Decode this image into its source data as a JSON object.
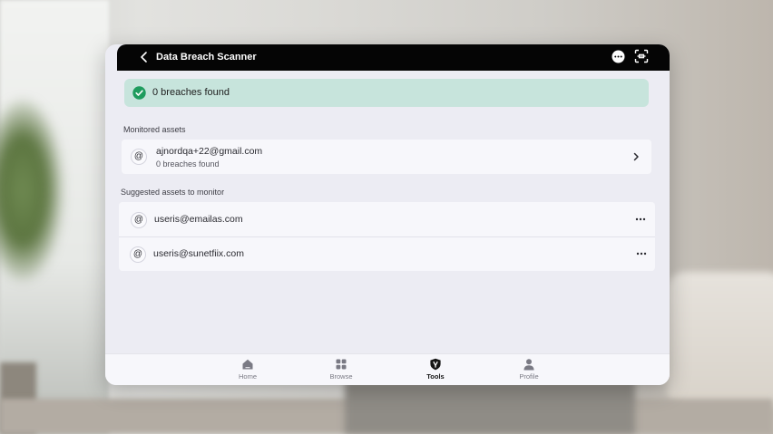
{
  "header": {
    "title": "Data Breach Scanner",
    "back_icon": "back-arrow-icon",
    "more_icon": "more-options-icon",
    "capture_icon": "screen-capture-icon"
  },
  "banner": {
    "text": "0 breaches found",
    "icon": "check-circle-icon",
    "color": "#c7e4dc",
    "icon_color": "#1f9c5e"
  },
  "monitored": {
    "label": "Monitored assets",
    "items": [
      {
        "icon": "@",
        "email": "ajnordqa+22@gmail.com",
        "status": "0 breaches found"
      }
    ]
  },
  "suggested": {
    "label": "Suggested assets to monitor",
    "items": [
      {
        "icon": "@",
        "email": "useris@emailas.com"
      },
      {
        "icon": "@",
        "email": "useris@sunetfiix.com"
      }
    ]
  },
  "nav": {
    "items": [
      {
        "label": "Home",
        "icon": "home-icon"
      },
      {
        "label": "Browse",
        "icon": "grid-icon"
      },
      {
        "label": "Tools",
        "icon": "shield-icon",
        "active": true
      },
      {
        "label": "Profile",
        "icon": "person-icon"
      }
    ]
  }
}
